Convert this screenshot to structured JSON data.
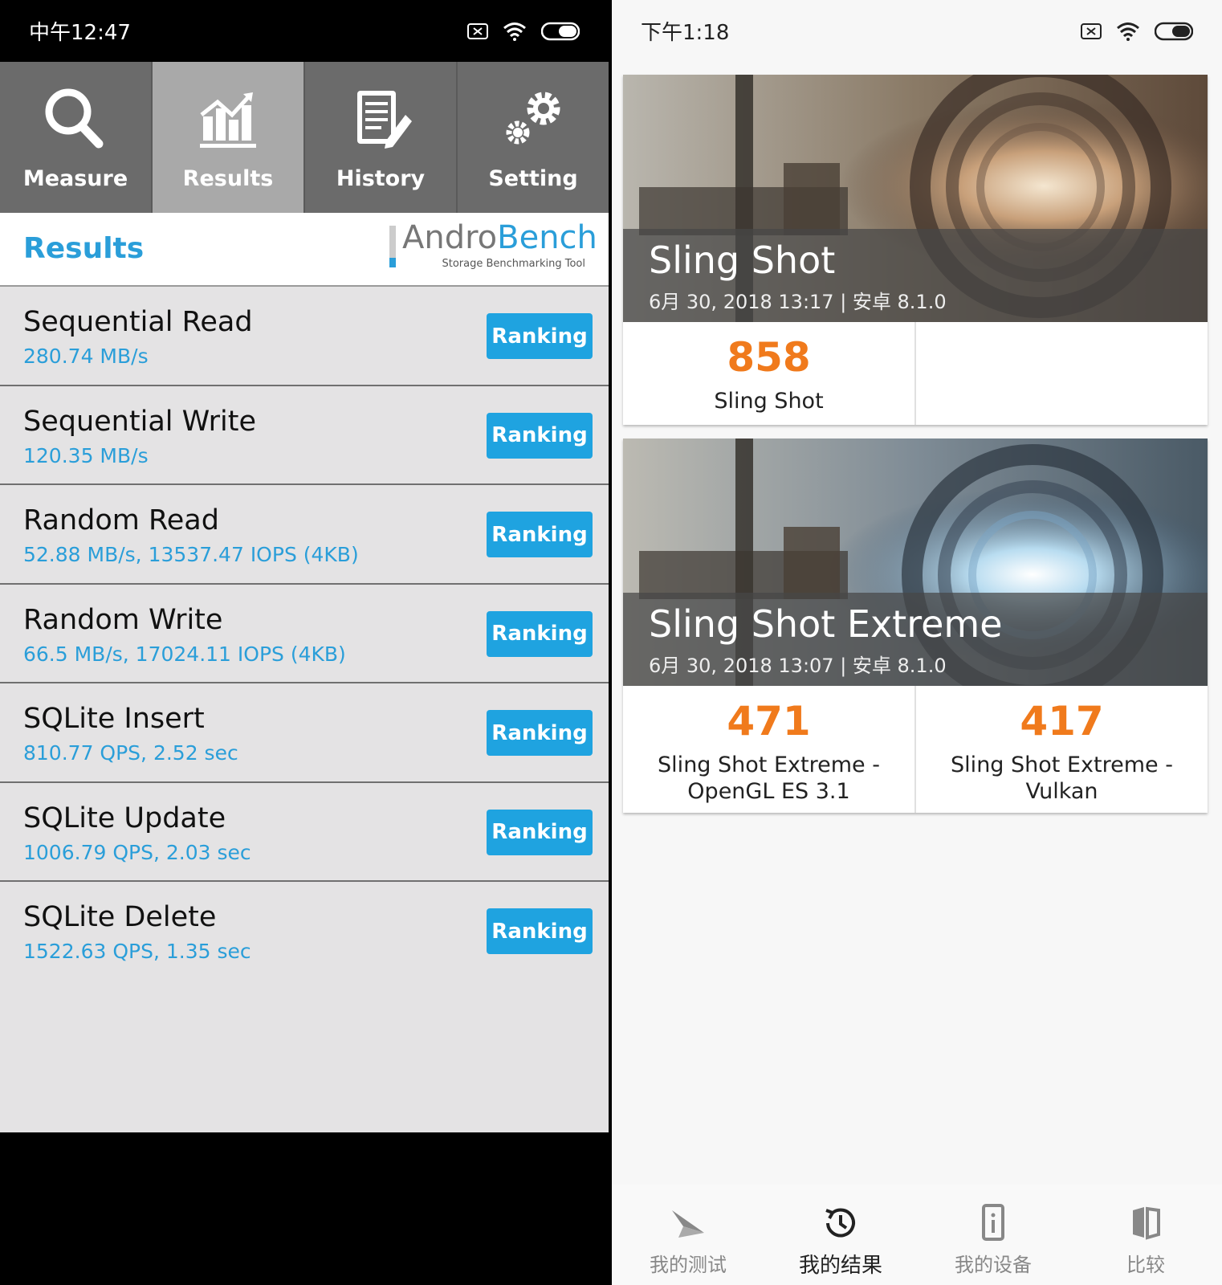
{
  "left": {
    "status": {
      "time": "中午12:47"
    },
    "tabs": [
      {
        "label": "Measure",
        "icon": "search-icon"
      },
      {
        "label": "Results",
        "icon": "chart-icon",
        "active": true
      },
      {
        "label": "History",
        "icon": "history-document-icon"
      },
      {
        "label": "Setting",
        "icon": "gear-icon"
      }
    ],
    "header": {
      "title": "Results",
      "logo_part1": "Andro",
      "logo_part2": "Bench",
      "logo_sub": "Storage Benchmarking Tool"
    },
    "rows": [
      {
        "name": "Sequential Read",
        "value": "280.74 MB/s",
        "button": "Ranking"
      },
      {
        "name": "Sequential Write",
        "value": "120.35 MB/s",
        "button": "Ranking"
      },
      {
        "name": "Random Read",
        "value": "52.88 MB/s, 13537.47 IOPS (4KB)",
        "button": "Ranking"
      },
      {
        "name": "Random Write",
        "value": "66.5 MB/s, 17024.11 IOPS (4KB)",
        "button": "Ranking"
      },
      {
        "name": "SQLite Insert",
        "value": "810.77 QPS, 2.52 sec",
        "button": "Ranking"
      },
      {
        "name": "SQLite Update",
        "value": "1006.79 QPS, 2.03 sec",
        "button": "Ranking"
      },
      {
        "name": "SQLite Delete",
        "value": "1522.63 QPS, 1.35 sec",
        "button": "Ranking"
      }
    ],
    "colors": {
      "accent": "#2a9ed9",
      "button": "#1fa3e0",
      "tab_bg": "#6b6b6b",
      "tab_active": "#a9a9a9"
    }
  },
  "right": {
    "status": {
      "time": "下午1:18"
    },
    "cards": [
      {
        "title": "Sling Shot",
        "subtitle": "6月 30, 2018 13:17 | 安卓 8.1.0",
        "scores": [
          {
            "value": "858",
            "label": "Sling Shot"
          },
          {
            "value": "",
            "label": ""
          }
        ]
      },
      {
        "title": "Sling Shot Extreme",
        "subtitle": "6月 30, 2018 13:07 | 安卓 8.1.0",
        "scores": [
          {
            "value": "471",
            "label": "Sling Shot Extreme -\nOpenGL ES 3.1"
          },
          {
            "value": "417",
            "label": "Sling Shot Extreme -\nVulkan"
          }
        ]
      }
    ],
    "nav": [
      {
        "label": "我的测试",
        "icon": "plane-icon"
      },
      {
        "label": "我的结果",
        "icon": "history-clock-icon",
        "active": true
      },
      {
        "label": "我的设备",
        "icon": "device-info-icon"
      },
      {
        "label": "比较",
        "icon": "compare-icon"
      }
    ],
    "colors": {
      "score": "#f07a1c"
    }
  }
}
